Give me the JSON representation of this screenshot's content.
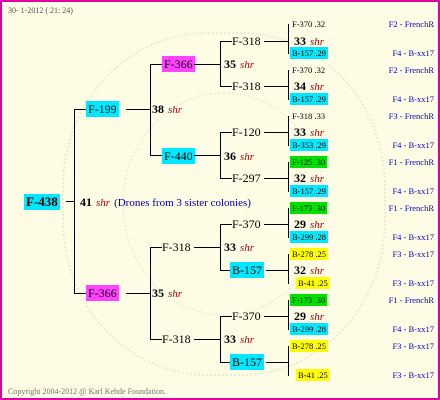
{
  "header_date": "30-  1-2012 ( 21: 24)",
  "copyright": "Copyright 2004-2012 @ Karl Kehde Foundation.",
  "root": {
    "id": "F-438",
    "count": "41",
    "shr": "shr",
    "note": "(Drones from 3 sister colonies)"
  },
  "gen1": [
    {
      "id": "F-199",
      "count": "38",
      "shr": "shr"
    },
    {
      "id": "F-366",
      "count": "35",
      "shr": "shr"
    }
  ],
  "gen2": [
    {
      "id": "F-366",
      "count": "35",
      "shr": "shr"
    },
    {
      "id": "F-440",
      "count": "36",
      "shr": "shr"
    },
    {
      "id": "F-318",
      "count": "33",
      "shr": "shr"
    },
    {
      "id": "F-318",
      "count": "33",
      "shr": "shr"
    }
  ],
  "gen3": [
    {
      "id": "F-318",
      "count": "33",
      "shr": "shr"
    },
    {
      "id": "F-318",
      "count": "34",
      "shr": "shr"
    },
    {
      "id": "F-120",
      "count": "33",
      "shr": "shr"
    },
    {
      "id": "F-297",
      "count": "32",
      "shr": "shr"
    },
    {
      "id": "F-370",
      "count": "29",
      "shr": "shr"
    },
    {
      "id": "B-157",
      "count": "32",
      "shr": "shr"
    },
    {
      "id": "F-370",
      "count": "29",
      "shr": "shr"
    },
    {
      "id": "B-157",
      "count": "",
      "shr": ""
    }
  ],
  "leaves": [
    {
      "id": "F-370",
      "val": ".32",
      "right": "F2 - FrenchR"
    },
    {
      "id": "B-157",
      "val": ".29",
      "right": "F4 - B-xx17"
    },
    {
      "id": "F-370",
      "val": ".32",
      "right": "F2 - FrenchR"
    },
    {
      "id": "B-157",
      "val": ".29",
      "right": "F4 - B-xx17"
    },
    {
      "id": "F-318",
      "val": ".33",
      "right": "F3 - FrenchR"
    },
    {
      "id": "B-353",
      "val": ".29",
      "right": "F4 - B-xx17"
    },
    {
      "id": "F-125",
      "val": ".30",
      "right": "F1 - FrenchR"
    },
    {
      "id": "B-157",
      "val": ".29",
      "right": "F4 - B-xx17"
    },
    {
      "id": "F-173",
      "val": ".30",
      "right": "F1 - FrenchR"
    },
    {
      "id": "B-299",
      "val": ".28",
      "right": "F4 - B-xx17"
    },
    {
      "id": "B-278",
      "val": ".25",
      "right": "F3 - B-xx17"
    },
    {
      "id": "B-41",
      "val": ".25",
      "right": "F3 - B-xx17"
    },
    {
      "id": "F-173",
      "val": ".30",
      "right": "F1 - FrenchR"
    },
    {
      "id": "B-299",
      "val": ".28",
      "right": "F4 - B-xx17"
    },
    {
      "id": "B-278",
      "val": ".25",
      "right": "F3 - B-xx17"
    },
    {
      "id": "B-41",
      "val": ".25",
      "right": "F3 - B-xx17"
    }
  ]
}
